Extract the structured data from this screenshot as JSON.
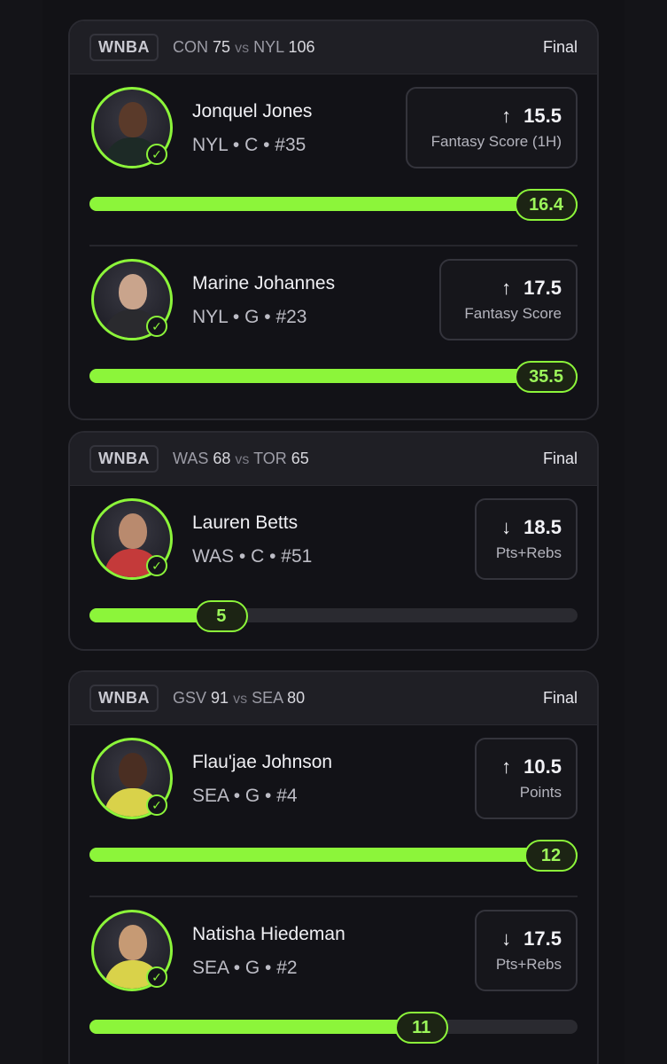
{
  "cards": [
    {
      "league": "WNBA",
      "away_team": "CON",
      "away_score": "75",
      "vs": "vs",
      "home_team": "NYL",
      "home_score": "106",
      "status": "Final",
      "players": [
        {
          "name": "Jonquel Jones",
          "meta": "NYL • C • #35",
          "direction": "↑",
          "line": "15.5",
          "stat": "Fantasy Score (1H)",
          "actual": "16.4",
          "progress": 1.0
        },
        {
          "name": "Marine Johannes",
          "meta": "NYL • G • #23",
          "direction": "↑",
          "line": "17.5",
          "stat": "Fantasy Score",
          "actual": "35.5",
          "progress": 1.0
        }
      ]
    },
    {
      "league": "WNBA",
      "away_team": "WAS",
      "away_score": "68",
      "vs": "vs",
      "home_team": "TOR",
      "home_score": "65",
      "status": "Final",
      "players": [
        {
          "name": "Lauren Betts",
          "meta": "WAS • C • #51",
          "direction": "↓",
          "line": "18.5",
          "stat": "Pts+Rebs",
          "actual": "5",
          "progress": 0.27
        }
      ]
    },
    {
      "league": "WNBA",
      "away_team": "GSV",
      "away_score": "91",
      "vs": "vs",
      "home_team": "SEA",
      "home_score": "80",
      "status": "Final",
      "players": [
        {
          "name": "Flau'jae Johnson",
          "meta": "SEA • G • #4",
          "direction": "↑",
          "line": "10.5",
          "stat": "Points",
          "actual": "12",
          "progress": 1.0
        },
        {
          "name": "Natisha Hiedeman",
          "meta": "SEA • G • #2",
          "direction": "↓",
          "line": "17.5",
          "stat": "Pts+Rebs",
          "actual": "11",
          "progress": 0.68
        }
      ]
    }
  ],
  "colors": {
    "accent": "#8cf53a",
    "card_bg": "#121217",
    "header_bg": "#1f1f25"
  }
}
